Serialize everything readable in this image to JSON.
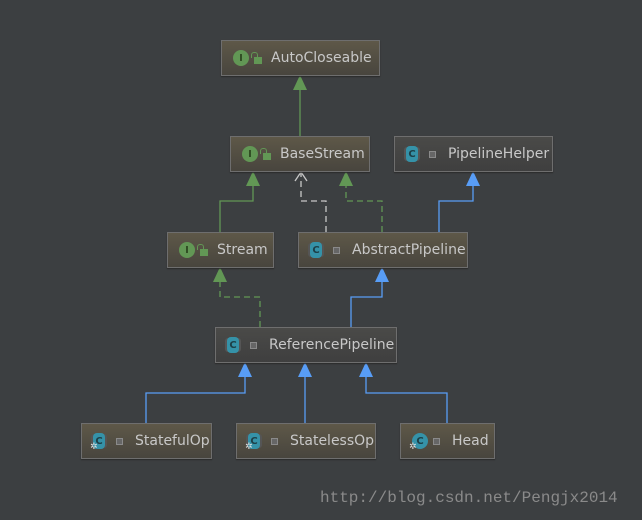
{
  "diagram": {
    "nodes": [
      {
        "id": "autocloseable",
        "label": "AutoCloseable",
        "kind": "interface"
      },
      {
        "id": "basestream",
        "label": "BaseStream",
        "kind": "interface"
      },
      {
        "id": "pipelinehelper",
        "label": "PipelineHelper",
        "kind": "abstract-class"
      },
      {
        "id": "stream",
        "label": "Stream",
        "kind": "interface"
      },
      {
        "id": "abstractpipeline",
        "label": "AbstractPipeline",
        "kind": "abstract-class"
      },
      {
        "id": "referencepipeline",
        "label": "ReferencePipeline",
        "kind": "abstract-class"
      },
      {
        "id": "statefulop",
        "label": "StatefulOp",
        "kind": "abstract-inner-class"
      },
      {
        "id": "statelessop",
        "label": "StatelessOp",
        "kind": "abstract-inner-class"
      },
      {
        "id": "head",
        "label": "Head",
        "kind": "inner-class"
      }
    ],
    "edges": [
      {
        "from": "BaseStream",
        "to": "AutoCloseable",
        "type": "extends-interface"
      },
      {
        "from": "Stream",
        "to": "BaseStream",
        "type": "extends-interface"
      },
      {
        "from": "AbstractPipeline",
        "to": "BaseStream",
        "type": "implements"
      },
      {
        "from": "AbstractPipeline",
        "to": "BaseStream",
        "type": "dependency"
      },
      {
        "from": "AbstractPipeline",
        "to": "PipelineHelper",
        "type": "extends"
      },
      {
        "from": "ReferencePipeline",
        "to": "Stream",
        "type": "implements"
      },
      {
        "from": "ReferencePipeline",
        "to": "AbstractPipeline",
        "type": "extends"
      },
      {
        "from": "StatefulOp",
        "to": "ReferencePipeline",
        "type": "extends"
      },
      {
        "from": "StatelessOp",
        "to": "ReferencePipeline",
        "type": "extends"
      },
      {
        "from": "Head",
        "to": "ReferencePipeline",
        "type": "extends"
      }
    ],
    "colors": {
      "background": "#3c3f41",
      "interface_edge": "#629755",
      "class_edge": "#589df6",
      "dependency_edge": "#c8c8c8"
    },
    "icon_letters": {
      "interface": "I",
      "class": "C"
    }
  },
  "watermark": "http://blog.csdn.net/Pengjx2014"
}
